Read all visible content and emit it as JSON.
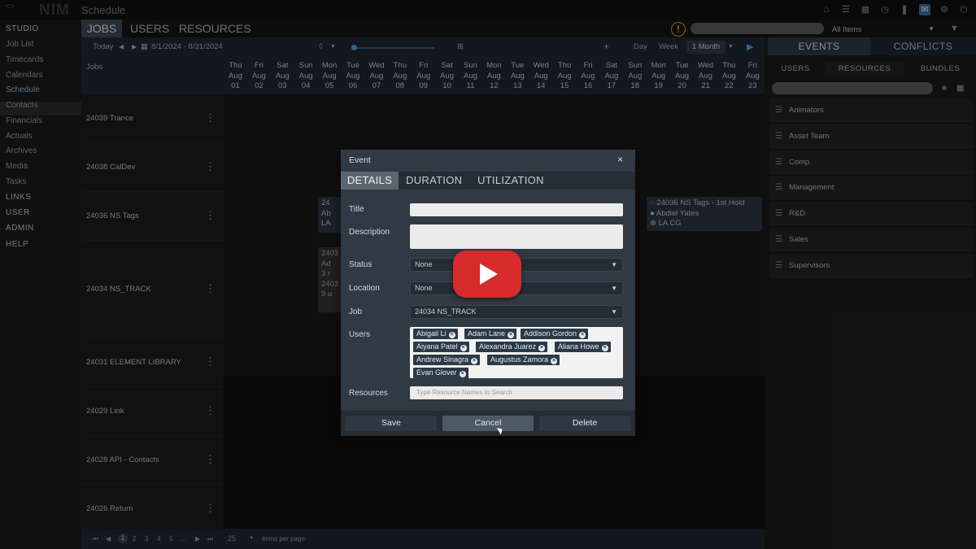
{
  "app": {
    "logo": "NIM",
    "page": "Schedule"
  },
  "sidebar": {
    "items": [
      {
        "label": "STUDIO",
        "section": true
      },
      {
        "label": "Job List"
      },
      {
        "label": "Timecards"
      },
      {
        "label": "Calendars"
      },
      {
        "label": "Schedule",
        "active": true
      },
      {
        "label": "Contacts"
      },
      {
        "label": "Financials"
      },
      {
        "label": "Actuals"
      },
      {
        "label": "Archives"
      },
      {
        "label": "Media"
      },
      {
        "label": "Tasks"
      },
      {
        "label": "LINKS",
        "section": true
      },
      {
        "label": "USER",
        "section": true
      },
      {
        "label": "ADMIN",
        "section": true
      },
      {
        "label": "HELP",
        "section": true
      }
    ]
  },
  "tabs": {
    "jobs": "JOBS",
    "users": "USERS",
    "resources": "RESOURCES"
  },
  "topbar": {
    "filter": "All Items",
    "alert_symbol": "!"
  },
  "toolbar": {
    "today": "Today",
    "date_range": "8/1/2024 - 8/31/2024",
    "plus": "+",
    "day": "Day",
    "week": "Week",
    "month": "1 Month"
  },
  "grid": {
    "jobs_header": "Jobs",
    "days": [
      [
        "Thu",
        "Aug",
        "01"
      ],
      [
        "Fri",
        "Aug",
        "02"
      ],
      [
        "Sat",
        "Aug",
        "03"
      ],
      [
        "Sun",
        "Aug",
        "04"
      ],
      [
        "Mon",
        "Aug",
        "05"
      ],
      [
        "Tue",
        "Aug",
        "06"
      ],
      [
        "Wed",
        "Aug",
        "07"
      ],
      [
        "Thu",
        "Aug",
        "08"
      ],
      [
        "Fri",
        "Aug",
        "09"
      ],
      [
        "Sat",
        "Aug",
        "10"
      ],
      [
        "Sun",
        "Aug",
        "11"
      ],
      [
        "Mon",
        "Aug",
        "12"
      ],
      [
        "Tue",
        "Aug",
        "13"
      ],
      [
        "Wed",
        "Aug",
        "14"
      ],
      [
        "Thu",
        "Aug",
        "15"
      ],
      [
        "Fri",
        "Aug",
        "16"
      ],
      [
        "Sat",
        "Aug",
        "17"
      ],
      [
        "Sun",
        "Aug",
        "18"
      ],
      [
        "Mon",
        "Aug",
        "19"
      ],
      [
        "Tue",
        "Aug",
        "20"
      ],
      [
        "Wed",
        "Aug",
        "21"
      ],
      [
        "Thu",
        "Aug",
        "22"
      ],
      [
        "Fri",
        "Aug",
        "23"
      ]
    ],
    "jobs": [
      "24039 Trance",
      "24038 CalDev",
      "24036 NS Tags",
      "24034 NS_TRACK",
      "24031 ELEMENT LIBRARY",
      "24029 Link",
      "24028 API - Contacts",
      "24026 Return"
    ],
    "event_right": {
      "title": "24036 NS Tags - 1st Hold",
      "user": "Abdiel Yates",
      "resource": "LA CG"
    },
    "event_left_1": {
      "l1": "24",
      "l2": "Ab",
      "l3": "LA"
    },
    "event_left_2": {
      "l1": "2403",
      "l2": "Ad",
      "l3": "3 r",
      "l4": "2403",
      "l5": "9 u"
    }
  },
  "pager": {
    "first": "⏮",
    "prev": "◀",
    "pages": [
      "1",
      "2",
      "3",
      "4",
      "5",
      "..."
    ],
    "next": "▶",
    "last": "⏭",
    "page_size": "25",
    "items_per_page": "items per page"
  },
  "right_panel": {
    "tabs": {
      "events": "EVENTS",
      "conflicts": "CONFLICTS"
    },
    "subtabs": {
      "users": "USERS",
      "resources": "RESOURCES",
      "bundles": "BUNDLES"
    },
    "groups": [
      "Animators",
      "Asset Team",
      "Comp",
      "Management",
      "R&D",
      "Sales",
      "Supervisors"
    ]
  },
  "modal": {
    "title": "Event",
    "close": "×",
    "tabs": {
      "details": "DETAILS",
      "duration": "DURATION",
      "utilization": "UTILIZATION"
    },
    "labels": {
      "title": "Title",
      "description": "Description",
      "status": "Status",
      "location": "Location",
      "job": "Job",
      "users": "Users",
      "resources": "Resources"
    },
    "values": {
      "title": "",
      "description": "",
      "status": "None",
      "location": "None",
      "job": "24034 NS_TRACK"
    },
    "users": [
      "Abigail Li",
      "Adam Lane",
      "Addison Gordon",
      "Aiyana Patel",
      "Alexandra Juarez",
      "Aliana Howe",
      "Andrew Sinagra",
      "Augustus Zamora",
      "Evan Glover"
    ],
    "resources_placeholder": "Type Resource Names to Search",
    "buttons": {
      "save": "Save",
      "cancel": "Cancel",
      "delete": "Delete"
    }
  }
}
